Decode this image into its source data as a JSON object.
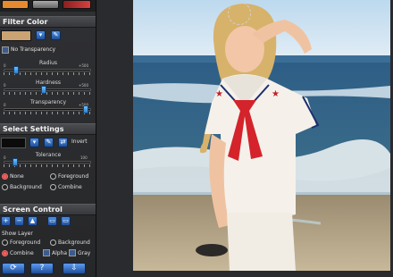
{
  "filter_color": {
    "title": "Filter Color",
    "swatch_color": "#c9a373",
    "no_transparency_label": "No Transparency",
    "radius_label": "Radius",
    "hardness_label": "Hardness",
    "transparency_label": "Transparency",
    "scale_min": "0",
    "scale_max": "+500",
    "radius_value": 0.12,
    "hardness_value": 0.46,
    "transparency_value": 0.97
  },
  "select_settings": {
    "title": "Select Settings",
    "invert_label": "Invert",
    "tolerance_label": "Tolerance",
    "tol_min": "0",
    "tol_max": "100",
    "tolerance_value": 0.11,
    "options": [
      "None",
      "Foreground",
      "Background",
      "Combine"
    ],
    "selected": "None"
  },
  "screen_control": {
    "title": "Screen Control",
    "show_layer_label": "Show Layer",
    "layer_options": [
      "Foreground",
      "Background",
      "Combine"
    ],
    "selected_layer": "Combine",
    "alpha_label": "Alpha",
    "gray_label": "Gray"
  },
  "icons": [
    "plus-icon",
    "minus-icon",
    "up-arrow-icon",
    "refresh-icon",
    "help-icon",
    "download-icon"
  ],
  "colors": {
    "accent_blue": "#2f6fd0",
    "radio_selected": "#ff4a4a",
    "panel_bg": "#2b2c2f"
  }
}
